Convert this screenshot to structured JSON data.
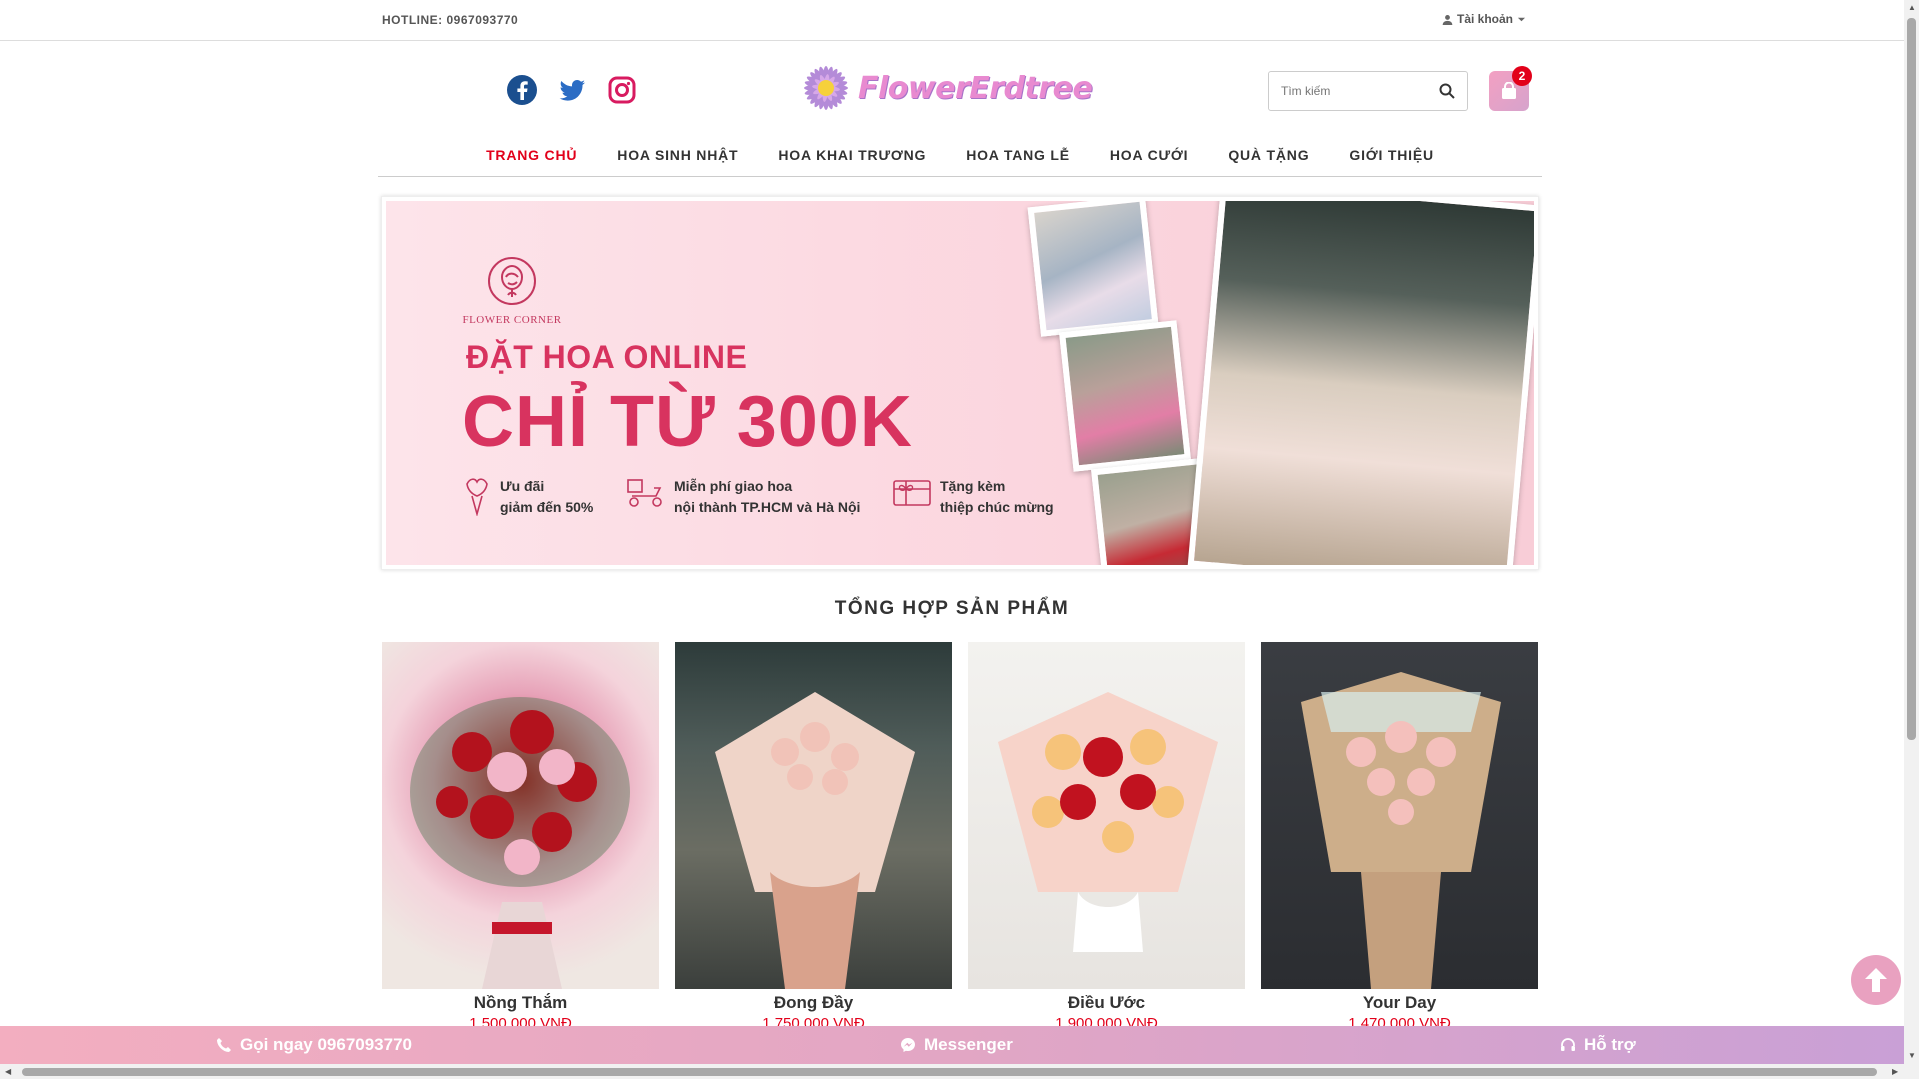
{
  "topbar": {
    "hotline": "HOTLINE: 0967093770",
    "account_label": "Tài khoản"
  },
  "header": {
    "logo_text": "FlowerErdtree",
    "search_placeholder": "Tìm kiếm",
    "cart_count": "2",
    "social": [
      "facebook-icon",
      "twitter-icon",
      "instagram-icon"
    ]
  },
  "nav": {
    "items": [
      "TRANG CHỦ",
      "HOA SINH NHẬT",
      "HOA KHAI TRƯƠNG",
      "HOA TANG LỄ",
      "HOA CƯỚI",
      "QUÀ TẶNG",
      "GIỚI THIỆU"
    ],
    "active_index": 0
  },
  "banner": {
    "brand": "FLOWER CORNER",
    "headline1": "ĐẶT HOA ONLINE",
    "headline2": "CHỈ TỪ 300K",
    "perks": [
      {
        "line1": "Ưu đãi",
        "line2": "giảm đến 50%"
      },
      {
        "line1": "Miễn phí giao hoa",
        "line2": "nội thành TP.HCM và Hà Nội"
      },
      {
        "line1": "Tặng kèm",
        "line2": "thiệp chúc mừng"
      }
    ]
  },
  "section": {
    "title": "TỔNG HỢP SẢN PHẨM"
  },
  "products": [
    {
      "name": "Nồng Thắm",
      "price": "1.500.000 VNĐ"
    },
    {
      "name": "Đong Đầy",
      "price": "1.750.000 VNĐ"
    },
    {
      "name": "Điều Ước",
      "price": "1.900.000 VNĐ"
    },
    {
      "name": "Your Day",
      "price": "1.470.000 VNĐ"
    }
  ],
  "bottombar": {
    "call": "Gọi ngay 0967093770",
    "messenger": "Messenger",
    "support": "Hỗ trợ"
  },
  "colors": {
    "accent": "#e2001a",
    "banner_text": "#d8335f",
    "logo": "#e88ad0"
  }
}
